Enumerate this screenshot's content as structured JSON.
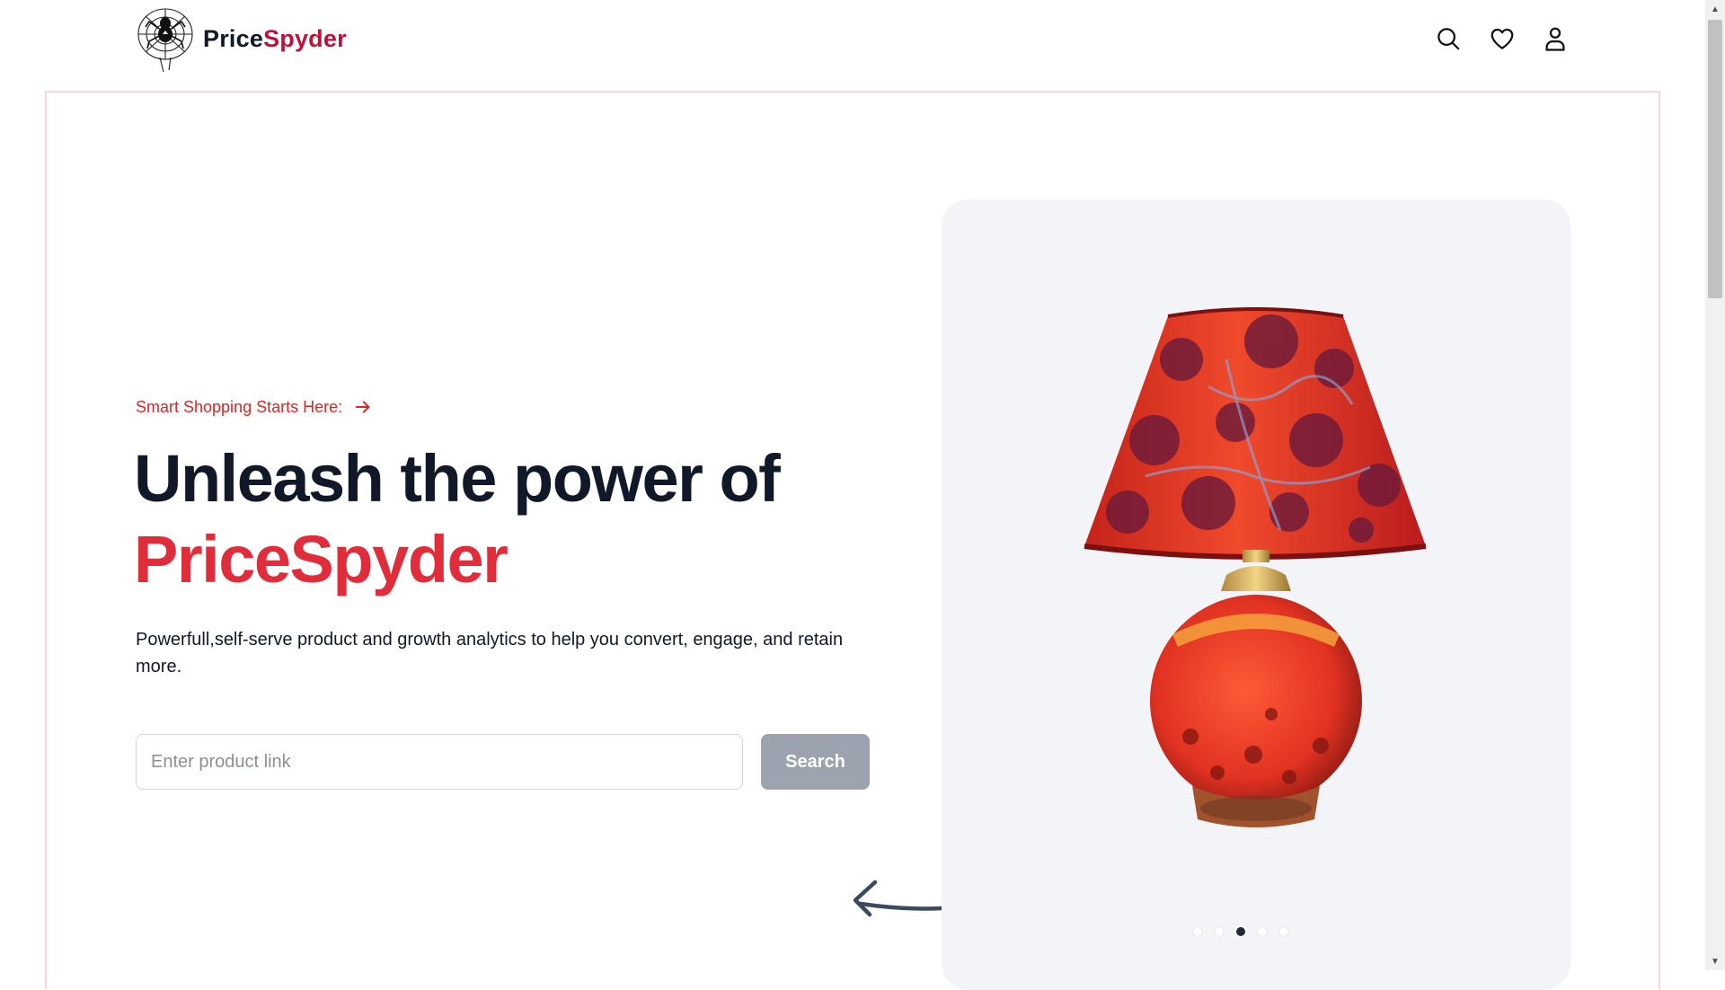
{
  "header": {
    "logo_part1": "Price",
    "logo_part2": "Spyder",
    "icons": [
      "search-icon",
      "heart-icon",
      "user-icon"
    ]
  },
  "hero": {
    "eyebrow": "Smart Shopping Starts Here:",
    "title_line1": "Unleash the power of",
    "title_line2": "PriceSpyder",
    "description": "Powerfull,self-serve product and growth analytics to help you convert, engage, and retain more.",
    "input_placeholder": "Enter product link",
    "input_value": "",
    "button_label": "Search"
  },
  "carousel": {
    "slide_count": 5,
    "active_index": 2
  },
  "colors": {
    "brand_red": "#e02d3c",
    "logo_red": "#be123c",
    "dark_text": "#111827",
    "button_gray": "#9ca3af",
    "card_bg": "#f3f4f7"
  }
}
